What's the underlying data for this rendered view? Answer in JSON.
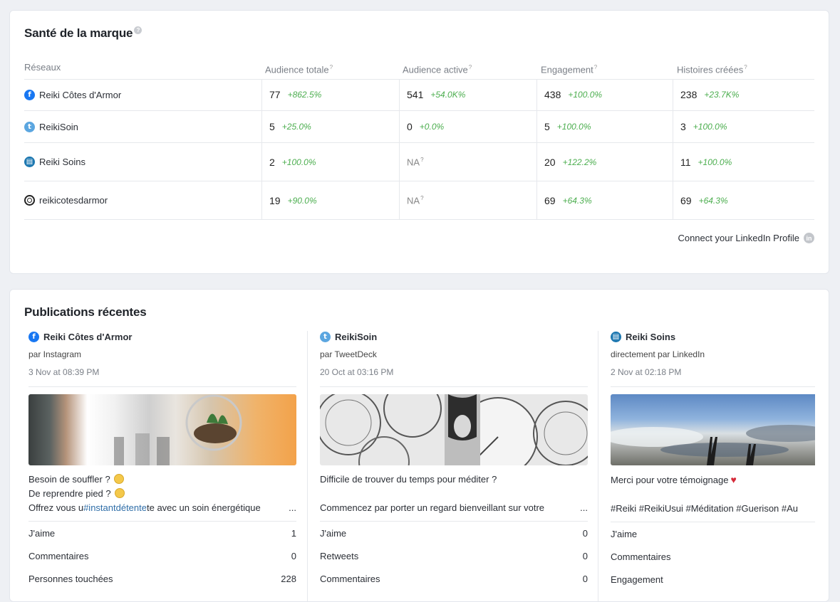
{
  "health": {
    "title": "Santé de la marque",
    "help": "?",
    "columns": [
      "Réseaux",
      "Audience totale",
      "Audience active",
      "Engagement",
      "Histoires créées"
    ],
    "column_help": "?",
    "rows": [
      {
        "network": "facebook",
        "name": "Reiki Côtes d'Armor",
        "cells": [
          {
            "v": "77",
            "p": "+862.5%"
          },
          {
            "v": "541",
            "p": "+54.0K%"
          },
          {
            "v": "438",
            "p": "+100.0%"
          },
          {
            "v": "238",
            "p": "+23.7K%"
          }
        ]
      },
      {
        "network": "twitter",
        "name": "ReikiSoin",
        "cells": [
          {
            "v": "5",
            "p": "+25.0%"
          },
          {
            "v": "0",
            "p": "+0.0%"
          },
          {
            "v": "5",
            "p": "+100.0%"
          },
          {
            "v": "3",
            "p": "+100.0%"
          }
        ]
      },
      {
        "network": "linkedin",
        "name": "Reiki Soins",
        "cells": [
          {
            "v": "2",
            "p": "+100.0%"
          },
          {
            "na": "NA"
          },
          {
            "v": "20",
            "p": "+122.2%"
          },
          {
            "v": "11",
            "p": "+100.0%"
          }
        ]
      },
      {
        "network": "instagram",
        "name": "reikicotesdarmor",
        "cells": [
          {
            "v": "19",
            "p": "+90.0%"
          },
          {
            "na": "NA"
          },
          {
            "v": "69",
            "p": "+64.3%"
          },
          {
            "v": "69",
            "p": "+64.3%"
          }
        ]
      }
    ],
    "connect_label": "Connect your LinkedIn Profile",
    "connect_icon": "in"
  },
  "recent": {
    "title": "Publications récentes",
    "posts": [
      {
        "network": "facebook",
        "name": "Reiki Côtes d'Armor",
        "via": "par Instagram",
        "date": "3 Nov at 08:39 PM",
        "lines": [
          "Besoin de souffler ?",
          "De reprendre pied ?",
          "Offrez vous u",
          "#instantdétente",
          "te avec un soin énergétique"
        ],
        "more": "...",
        "stats": [
          {
            "label": "J'aime",
            "value": "1"
          },
          {
            "label": "Commentaires",
            "value": "0"
          },
          {
            "label": "Personnes touchées",
            "value": "228"
          }
        ]
      },
      {
        "network": "twitter",
        "name": "ReikiSoin",
        "via": "par TweetDeck",
        "date": "20 Oct at 03:16 PM",
        "lines": [
          "Difficile de trouver du temps pour méditer ?",
          "Commencez par porter un regard bienveillant sur votre"
        ],
        "more": "...",
        "stats": [
          {
            "label": "J'aime",
            "value": "0"
          },
          {
            "label": "Retweets",
            "value": "0"
          },
          {
            "label": "Commentaires",
            "value": "0"
          }
        ]
      },
      {
        "network": "linkedin",
        "name": "Reiki Soins",
        "via": "directement par LinkedIn",
        "date": "2 Nov at 02:18 PM",
        "lines": [
          "Merci pour votre témoignage",
          "#Reiki #ReikiUsui #Méditation #Guerison #Au"
        ],
        "stats": [
          {
            "label": "J'aime",
            "value": ""
          },
          {
            "label": "Commentaires",
            "value": ""
          },
          {
            "label": "Engagement",
            "value": ""
          }
        ]
      }
    ]
  },
  "colors": {
    "positive": "#4cae4f",
    "facebook": "#1877f2",
    "twitter": "#5ba6e0",
    "linkedin": "#1c77b0",
    "hashtag": "#2f6ea8"
  }
}
